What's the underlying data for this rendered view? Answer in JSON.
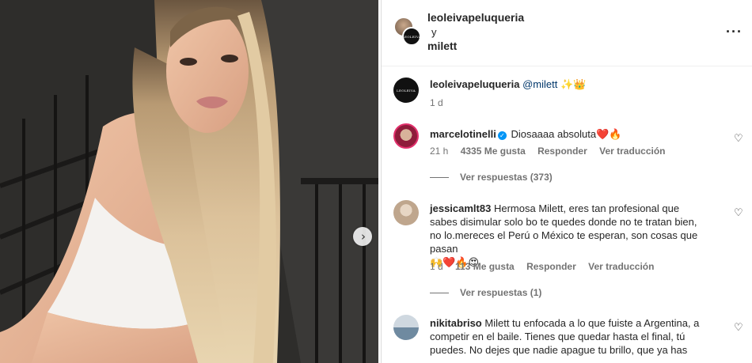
{
  "post": {
    "carousel_next_icon": "chevron-right-icon"
  },
  "header": {
    "user1": "leoleivapeluqueria",
    "connector": "y",
    "user2": "milett",
    "more_icon": "more-options-icon",
    "logo_text": "LEOLEIVA"
  },
  "caption": {
    "username": "leoleivapeluqueria",
    "mention": "@milett",
    "emojis": "✨👑",
    "time": "1 d"
  },
  "comments": [
    {
      "username": "marcelotinelli",
      "verified": true,
      "text": "Diosaaaa absoluta",
      "emojis": "❤️🔥",
      "time": "21 h",
      "likes": "4335 Me gusta",
      "reply": "Responder",
      "translate": "Ver traducción",
      "replies": "Ver respuestas (373)"
    },
    {
      "username": "jessicamlt83",
      "text": "Hermosa Milett, eres tan profesional que sabes disimular solo bo te quedes donde no te tratan bien, no lo.mereces el Perú o México te esperan, son cosas que pasan",
      "emojis": "🙌❤️🔥😍",
      "time": "1 d",
      "likes": "113 Me gusta",
      "reply": "Responder",
      "translate": "Ver traducción",
      "replies": "Ver respuestas (1)"
    },
    {
      "username": "nikitabriso",
      "text": "Milett tu enfocada a lo que fuiste a Argentina, a competir en el baile. Tienes que quedar hasta el final, tú puedes. No dejes que nadie apague tu brillo, que ya has"
    }
  ],
  "colors": {
    "link": "#00376b",
    "muted": "#737373",
    "verified": "#0095f6",
    "text": "#262626"
  }
}
